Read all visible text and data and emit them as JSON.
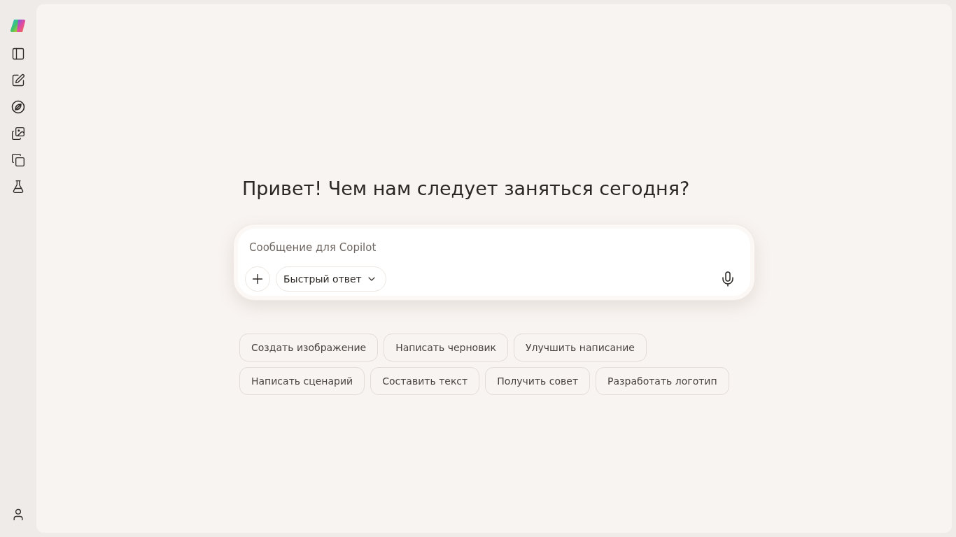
{
  "sidebar": {
    "items": [
      {
        "kind": "panel"
      },
      {
        "kind": "new"
      },
      {
        "kind": "discover"
      },
      {
        "kind": "images"
      },
      {
        "kind": "pages"
      },
      {
        "kind": "labs"
      }
    ]
  },
  "heading": "Привет! Чем нам следует заняться сегодня?",
  "composer": {
    "placeholder": "Сообщение для Copilot",
    "mode": "Быстрый ответ"
  },
  "suggestions": [
    [
      "Создать изображение",
      "Написать черновик",
      "Улучшить написание"
    ],
    [
      "Написать сценарий",
      "Составить текст",
      "Получить совет",
      "Разработать логотип"
    ]
  ]
}
